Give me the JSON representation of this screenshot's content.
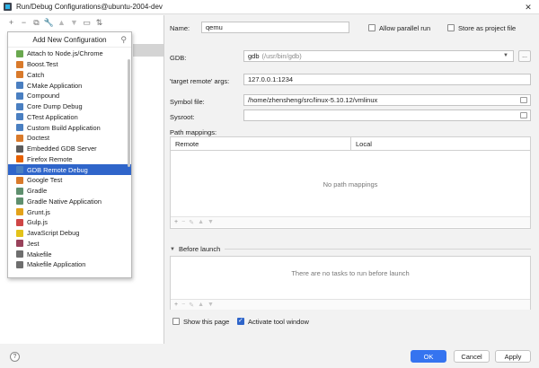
{
  "window": {
    "title": "Run/Debug Configurations@ubuntu-2004-dev"
  },
  "toolbar": {
    "icons": [
      "add-icon",
      "remove-icon",
      "copy-icon",
      "wrench-icon",
      "arrow-up-icon",
      "arrow-down-icon",
      "folder-icon",
      "sort-icon"
    ]
  },
  "popup": {
    "title": "Add New Configuration",
    "items": [
      {
        "label": "Attach to Node.js/Chrome",
        "icon": "node-icon",
        "color": "#6aa84f"
      },
      {
        "label": "Boost.Test",
        "icon": "boost-icon",
        "color": "#d97a2b"
      },
      {
        "label": "Catch",
        "icon": "catch-icon",
        "color": "#d97a2b"
      },
      {
        "label": "CMake Application",
        "icon": "cmake-icon",
        "color": "#4a7fc1"
      },
      {
        "label": "Compound",
        "icon": "compound-icon",
        "color": "#4a7fc1"
      },
      {
        "label": "Core Dump Debug",
        "icon": "coredump-icon",
        "color": "#4a7fc1"
      },
      {
        "label": "CTest Application",
        "icon": "ctest-icon",
        "color": "#4a7fc1"
      },
      {
        "label": "Custom Build Application",
        "icon": "custom-build-icon",
        "color": "#4a7fc1"
      },
      {
        "label": "Doctest",
        "icon": "doctest-icon",
        "color": "#d97a2b"
      },
      {
        "label": "Embedded GDB Server",
        "icon": "embedded-gdb-icon",
        "color": "#5b5b5b"
      },
      {
        "label": "Firefox Remote",
        "icon": "firefox-icon",
        "color": "#e66000"
      },
      {
        "label": "GDB Remote Debug",
        "icon": "gdb-remote-icon",
        "color": "#4a7fc1"
      },
      {
        "label": "Google Test",
        "icon": "google-test-icon",
        "color": "#d97a2b"
      },
      {
        "label": "Gradle",
        "icon": "gradle-icon",
        "color": "#5f8f6e"
      },
      {
        "label": "Gradle Native Application",
        "icon": "gradle-native-icon",
        "color": "#5f8f6e"
      },
      {
        "label": "Grunt.js",
        "icon": "grunt-icon",
        "color": "#e3a21a"
      },
      {
        "label": "Gulp.js",
        "icon": "gulp-icon",
        "color": "#cf4646"
      },
      {
        "label": "JavaScript Debug",
        "icon": "js-debug-icon",
        "color": "#e3c21a"
      },
      {
        "label": "Jest",
        "icon": "jest-icon",
        "color": "#99425b"
      },
      {
        "label": "Makefile",
        "icon": "makefile-icon",
        "color": "#6e6e6e"
      },
      {
        "label": "Makefile Application",
        "icon": "makefile-app-icon",
        "color": "#6e6e6e"
      }
    ],
    "selected_index": 11
  },
  "form": {
    "name_label": "Name:",
    "name_value": "qemu",
    "allow_parallel_label": "Allow parallel run",
    "allow_parallel_checked": false,
    "store_project_label": "Store as project file",
    "store_project_checked": false,
    "gdb_label": "GDB:",
    "gdb_value": "gdb",
    "gdb_path": "(/usr/bin/gdb)",
    "gdb_more": "...",
    "target_label": "'target remote' args:",
    "target_value": "127.0.0.1:1234",
    "symbol_label": "Symbol file:",
    "symbol_value": "/home/zhensheng/src/linux-5.10.12/vmlinux",
    "sysroot_label": "Sysroot:",
    "sysroot_value": "",
    "path_mappings_label": "Path mappings:",
    "col_remote": "Remote",
    "col_local": "Local",
    "no_mappings": "No path mappings",
    "before_launch_label": "Before launch",
    "no_tasks": "There are no tasks to run before launch",
    "show_page_label": "Show this page",
    "show_page_checked": false,
    "activate_tool_label": "Activate tool window",
    "activate_tool_checked": true
  },
  "buttons": {
    "help": "?",
    "ok": "OK",
    "cancel": "Cancel",
    "apply": "Apply"
  }
}
